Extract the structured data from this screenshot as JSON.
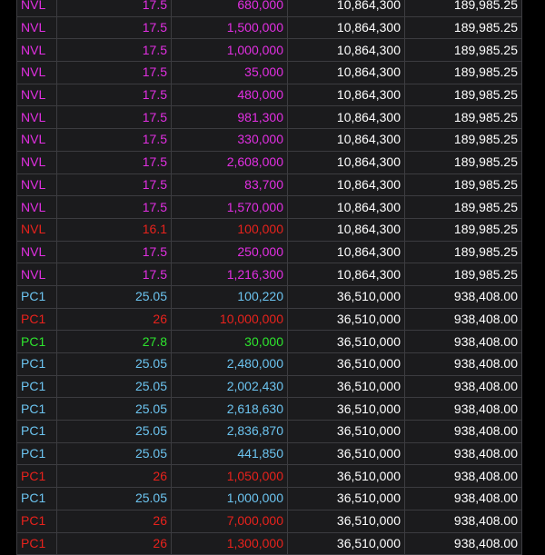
{
  "colors": {
    "magenta": "#e22fe2",
    "red": "#e8221c",
    "green": "#2ee52e",
    "blue": "#6cc4f0",
    "white": "#ffffff"
  },
  "rows": [
    {
      "symbol": "NVL",
      "price": "17.5",
      "volume": "680,000",
      "total_volume": "10,864,300",
      "total_value": "189,985.25",
      "color": "magenta"
    },
    {
      "symbol": "NVL",
      "price": "17.5",
      "volume": "1,500,000",
      "total_volume": "10,864,300",
      "total_value": "189,985.25",
      "color": "magenta"
    },
    {
      "symbol": "NVL",
      "price": "17.5",
      "volume": "1,000,000",
      "total_volume": "10,864,300",
      "total_value": "189,985.25",
      "color": "magenta"
    },
    {
      "symbol": "NVL",
      "price": "17.5",
      "volume": "35,000",
      "total_volume": "10,864,300",
      "total_value": "189,985.25",
      "color": "magenta"
    },
    {
      "symbol": "NVL",
      "price": "17.5",
      "volume": "480,000",
      "total_volume": "10,864,300",
      "total_value": "189,985.25",
      "color": "magenta"
    },
    {
      "symbol": "NVL",
      "price": "17.5",
      "volume": "981,300",
      "total_volume": "10,864,300",
      "total_value": "189,985.25",
      "color": "magenta"
    },
    {
      "symbol": "NVL",
      "price": "17.5",
      "volume": "330,000",
      "total_volume": "10,864,300",
      "total_value": "189,985.25",
      "color": "magenta"
    },
    {
      "symbol": "NVL",
      "price": "17.5",
      "volume": "2,608,000",
      "total_volume": "10,864,300",
      "total_value": "189,985.25",
      "color": "magenta"
    },
    {
      "symbol": "NVL",
      "price": "17.5",
      "volume": "83,700",
      "total_volume": "10,864,300",
      "total_value": "189,985.25",
      "color": "magenta"
    },
    {
      "symbol": "NVL",
      "price": "17.5",
      "volume": "1,570,000",
      "total_volume": "10,864,300",
      "total_value": "189,985.25",
      "color": "magenta"
    },
    {
      "symbol": "NVL",
      "price": "16.1",
      "volume": "100,000",
      "total_volume": "10,864,300",
      "total_value": "189,985.25",
      "color": "red"
    },
    {
      "symbol": "NVL",
      "price": "17.5",
      "volume": "250,000",
      "total_volume": "10,864,300",
      "total_value": "189,985.25",
      "color": "magenta"
    },
    {
      "symbol": "NVL",
      "price": "17.5",
      "volume": "1,216,300",
      "total_volume": "10,864,300",
      "total_value": "189,985.25",
      "color": "magenta"
    },
    {
      "symbol": "PC1",
      "price": "25.05",
      "volume": "100,220",
      "total_volume": "36,510,000",
      "total_value": "938,408.00",
      "color": "blue"
    },
    {
      "symbol": "PC1",
      "price": "26",
      "volume": "10,000,000",
      "total_volume": "36,510,000",
      "total_value": "938,408.00",
      "color": "red"
    },
    {
      "symbol": "PC1",
      "price": "27.8",
      "volume": "30,000",
      "total_volume": "36,510,000",
      "total_value": "938,408.00",
      "color": "green"
    },
    {
      "symbol": "PC1",
      "price": "25.05",
      "volume": "2,480,000",
      "total_volume": "36,510,000",
      "total_value": "938,408.00",
      "color": "blue"
    },
    {
      "symbol": "PC1",
      "price": "25.05",
      "volume": "2,002,430",
      "total_volume": "36,510,000",
      "total_value": "938,408.00",
      "color": "blue"
    },
    {
      "symbol": "PC1",
      "price": "25.05",
      "volume": "2,618,630",
      "total_volume": "36,510,000",
      "total_value": "938,408.00",
      "color": "blue"
    },
    {
      "symbol": "PC1",
      "price": "25.05",
      "volume": "2,836,870",
      "total_volume": "36,510,000",
      "total_value": "938,408.00",
      "color": "blue"
    },
    {
      "symbol": "PC1",
      "price": "25.05",
      "volume": "441,850",
      "total_volume": "36,510,000",
      "total_value": "938,408.00",
      "color": "blue"
    },
    {
      "symbol": "PC1",
      "price": "26",
      "volume": "1,050,000",
      "total_volume": "36,510,000",
      "total_value": "938,408.00",
      "color": "red"
    },
    {
      "symbol": "PC1",
      "price": "25.05",
      "volume": "1,000,000",
      "total_volume": "36,510,000",
      "total_value": "938,408.00",
      "color": "blue"
    },
    {
      "symbol": "PC1",
      "price": "26",
      "volume": "7,000,000",
      "total_volume": "36,510,000",
      "total_value": "938,408.00",
      "color": "red"
    },
    {
      "symbol": "PC1",
      "price": "26",
      "volume": "1,300,000",
      "total_volume": "36,510,000",
      "total_value": "938,408.00",
      "color": "red"
    }
  ]
}
